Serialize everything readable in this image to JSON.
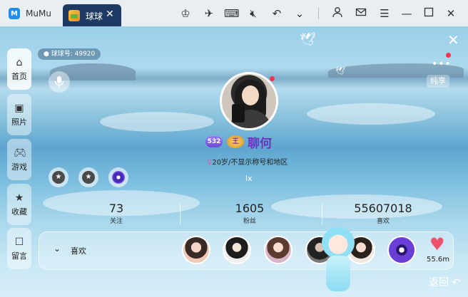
{
  "window": {
    "app_name": "MuMu",
    "tab_title": "球球",
    "tab_close": "✕"
  },
  "profile": {
    "uid_label": "球球号: 49920",
    "nickname": "聊何",
    "level": "532",
    "vip_label": "王",
    "bio": "20岁/不显示称号和地区",
    "signature": "lx",
    "share_label": "纯享"
  },
  "stats": [
    {
      "value": "73",
      "label": "关注"
    },
    {
      "value": "1605",
      "label": "粉丝"
    },
    {
      "value": "55607018",
      "label": "喜欢"
    }
  ],
  "likes": {
    "label": "喜欢",
    "count": "55.6m"
  },
  "nav": [
    {
      "label": "首页",
      "icon": "home-icon",
      "active": true
    },
    {
      "label": "照片",
      "icon": "photo-icon",
      "active": false
    },
    {
      "label": "游戏",
      "icon": "gamepad-icon",
      "active": false
    },
    {
      "label": "收藏",
      "icon": "star-icon",
      "active": false
    },
    {
      "label": "留言",
      "icon": "message-icon",
      "active": false
    }
  ],
  "footer": {
    "back_label": "返回"
  },
  "colors": {
    "nickname": "#6a33c6",
    "heart": "#f0506a",
    "tab_bg": "#1e3a62",
    "notify_dot": "#f1324a"
  }
}
